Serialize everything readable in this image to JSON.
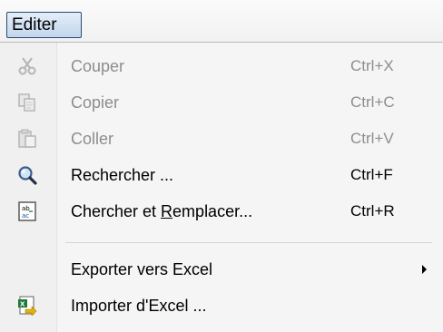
{
  "menubar": {
    "editer_label": "Editer"
  },
  "menu": {
    "items": [
      {
        "label": "Couper",
        "shortcut": "Ctrl+X",
        "icon": "cut-icon",
        "enabled": false
      },
      {
        "label": "Copier",
        "shortcut": "Ctrl+C",
        "icon": "copy-icon",
        "enabled": false
      },
      {
        "label": "Coller",
        "shortcut": "Ctrl+V",
        "icon": "paste-icon",
        "enabled": false
      },
      {
        "label": "Rechercher ...",
        "shortcut": "Ctrl+F",
        "icon": "search-icon",
        "enabled": true
      },
      {
        "label_pre": "Chercher et ",
        "label_mnemonic": "R",
        "label_post": "emplacer...",
        "shortcut": "Ctrl+R",
        "icon": "replace-icon",
        "enabled": true
      },
      {
        "label": "Exporter vers Excel",
        "has_submenu": true,
        "enabled": true
      },
      {
        "label": "Importer d'Excel ...",
        "icon": "excel-import-icon",
        "enabled": true
      }
    ]
  },
  "colors": {
    "disabled_text": "#8d8d8d",
    "menubar_highlight": "#c3d6ec"
  }
}
